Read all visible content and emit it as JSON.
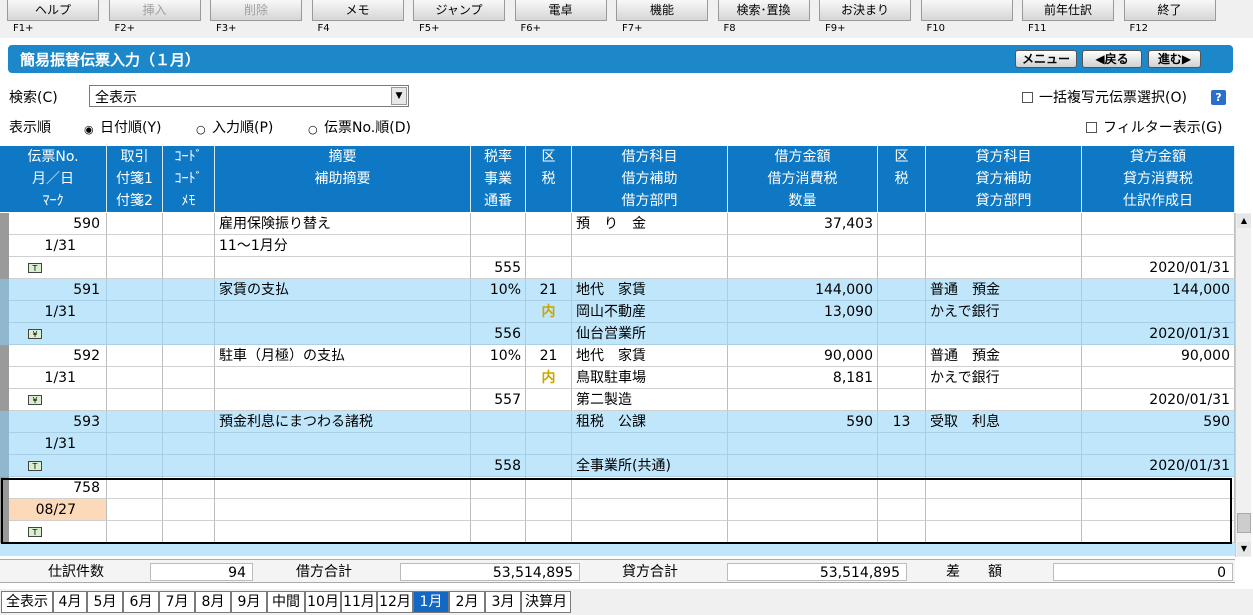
{
  "fkeys": [
    {
      "label": "ヘルプ",
      "key": "F1+",
      "disabled": false
    },
    {
      "label": "挿入",
      "key": "F2+",
      "disabled": true
    },
    {
      "label": "削除",
      "key": "F3+",
      "disabled": true
    },
    {
      "label": "メモ",
      "key": "F4",
      "disabled": false
    },
    {
      "label": "ジャンプ",
      "key": "F5+",
      "disabled": false
    },
    {
      "label": "電卓",
      "key": "F6+",
      "disabled": false
    },
    {
      "label": "機能",
      "key": "F7+",
      "disabled": false
    },
    {
      "label": "検索･置換",
      "key": "F8",
      "disabled": false
    },
    {
      "label": "お決まり",
      "key": "F9+",
      "disabled": false
    },
    {
      "label": "",
      "key": "F10",
      "disabled": false
    },
    {
      "label": "前年仕訳",
      "key": "F11",
      "disabled": false
    },
    {
      "label": "終了",
      "key": "F12",
      "disabled": false
    }
  ],
  "titlebar": {
    "title": "簡易振替伝票入力（１月）",
    "menu_label": "メニュー",
    "back_label": "◀戻る",
    "forward_label": "進む▶"
  },
  "search": {
    "label": "検索(C)",
    "value": "全表示"
  },
  "bulk_copy": {
    "label": "一括複写元伝票選択(O)",
    "checked": false
  },
  "help_label": "?",
  "order": {
    "label": "表示順",
    "options": [
      {
        "label": "日付順(Y)",
        "selected": true
      },
      {
        "label": "入力順(P)",
        "selected": false
      },
      {
        "label": "伝票No.順(D)",
        "selected": false
      }
    ]
  },
  "filter": {
    "label": "フィルター表示(G)",
    "checked": false
  },
  "headers": [
    [
      "伝票No.",
      "取引",
      "ｺｰﾄﾞ",
      "摘要",
      "税率",
      "区",
      "借方科目",
      "借方金額",
      "区",
      "貸方科目",
      "貸方金額"
    ],
    [
      "月／日",
      "付箋1",
      "ｺｰﾄﾞ",
      "補助摘要",
      "事業",
      "税",
      "借方補助",
      "借方消費税",
      "税",
      "貸方補助",
      "貸方消費税"
    ],
    [
      "ﾏｰｸ",
      "付箋2",
      "ﾒﾓ",
      "",
      "通番",
      "",
      "借方部門",
      "数量",
      "",
      "貸方部門",
      "仕訳作成日"
    ]
  ],
  "entries": [
    {
      "style": "white",
      "rows": [
        [
          "590",
          "",
          "",
          "雇用保険振り替え",
          "",
          "",
          "預　り　金",
          "37,403",
          "",
          "",
          ""
        ],
        [
          "1/31",
          "",
          "",
          "11～1月分",
          "",
          "",
          "",
          "",
          "",
          "",
          ""
        ],
        [
          "[T]",
          "",
          "",
          "",
          "555",
          "",
          "",
          "",
          "",
          "",
          "2020/01/31"
        ]
      ]
    },
    {
      "style": "blue",
      "rows": [
        [
          "591",
          "",
          "",
          "家賃の支払",
          "10%",
          "21",
          "地代　家賃",
          "144,000",
          "",
          "普通　預金",
          "144,000"
        ],
        [
          "1/31",
          "",
          "",
          "",
          "",
          "内",
          "岡山不動産",
          "13,090",
          "",
          "かえで銀行",
          ""
        ],
        [
          "[¥]",
          "",
          "",
          "",
          "556",
          "",
          "仙台営業所",
          "",
          "",
          "",
          "2020/01/31"
        ]
      ]
    },
    {
      "style": "white",
      "rows": [
        [
          "592",
          "",
          "",
          "駐車（月極）の支払",
          "10%",
          "21",
          "地代　家賃",
          "90,000",
          "",
          "普通　預金",
          "90,000"
        ],
        [
          "1/31",
          "",
          "",
          "",
          "",
          "内",
          "鳥取駐車場",
          "8,181",
          "",
          "かえで銀行",
          ""
        ],
        [
          "[¥]",
          "",
          "",
          "",
          "557",
          "",
          "第二製造",
          "",
          "",
          "",
          "2020/01/31"
        ]
      ]
    },
    {
      "style": "blue",
      "rows": [
        [
          "593",
          "",
          "",
          "預金利息にまつわる諸税",
          "",
          "",
          "租税　公課",
          "590",
          "13",
          "受取　利息",
          "590"
        ],
        [
          "1/31",
          "",
          "",
          "",
          "",
          "",
          "",
          "",
          "",
          "",
          ""
        ],
        [
          "[T]",
          "",
          "",
          "",
          "558",
          "",
          "全事業所(共通)",
          "",
          "",
          "",
          "2020/01/31"
        ]
      ]
    },
    {
      "style": "white",
      "rows": [
        [
          "758",
          "",
          "",
          "",
          "",
          "",
          "",
          "",
          "",
          "",
          ""
        ],
        [
          "08/27",
          "",
          "",
          "",
          "",
          "",
          "",
          "",
          "",
          "",
          ""
        ],
        [
          "[T]",
          "",
          "",
          "",
          "",
          "",
          "",
          "",
          "",
          "",
          ""
        ]
      ]
    }
  ],
  "totals": {
    "count_label": "仕訳件数",
    "count": "94",
    "debit_label": "借方合計",
    "debit": "53,514,895",
    "credit_label": "貸方合計",
    "credit": "53,514,895",
    "diff_label": "差　　額",
    "diff": "0"
  },
  "tabs": [
    {
      "label": "全表示",
      "active": false
    },
    {
      "label": "4月",
      "active": false
    },
    {
      "label": "5月",
      "active": false
    },
    {
      "label": "6月",
      "active": false
    },
    {
      "label": "7月",
      "active": false
    },
    {
      "label": "8月",
      "active": false
    },
    {
      "label": "9月",
      "active": false
    },
    {
      "label": "中間",
      "active": false
    },
    {
      "label": "10月",
      "active": false
    },
    {
      "label": "11月",
      "active": false
    },
    {
      "label": "12月",
      "active": false
    },
    {
      "label": "1月",
      "active": true
    },
    {
      "label": "2月",
      "active": false
    },
    {
      "label": "3月",
      "active": false
    },
    {
      "label": "決算月",
      "active": false
    }
  ],
  "colors": {
    "titlebar": "#1c87c9",
    "header": "#0f78c4",
    "row_blue": "#bfe6fb",
    "tab_active": "#1467c2",
    "edit_date_bg": "#fcd9b8",
    "tax_inclusive": "#c8a800"
  }
}
